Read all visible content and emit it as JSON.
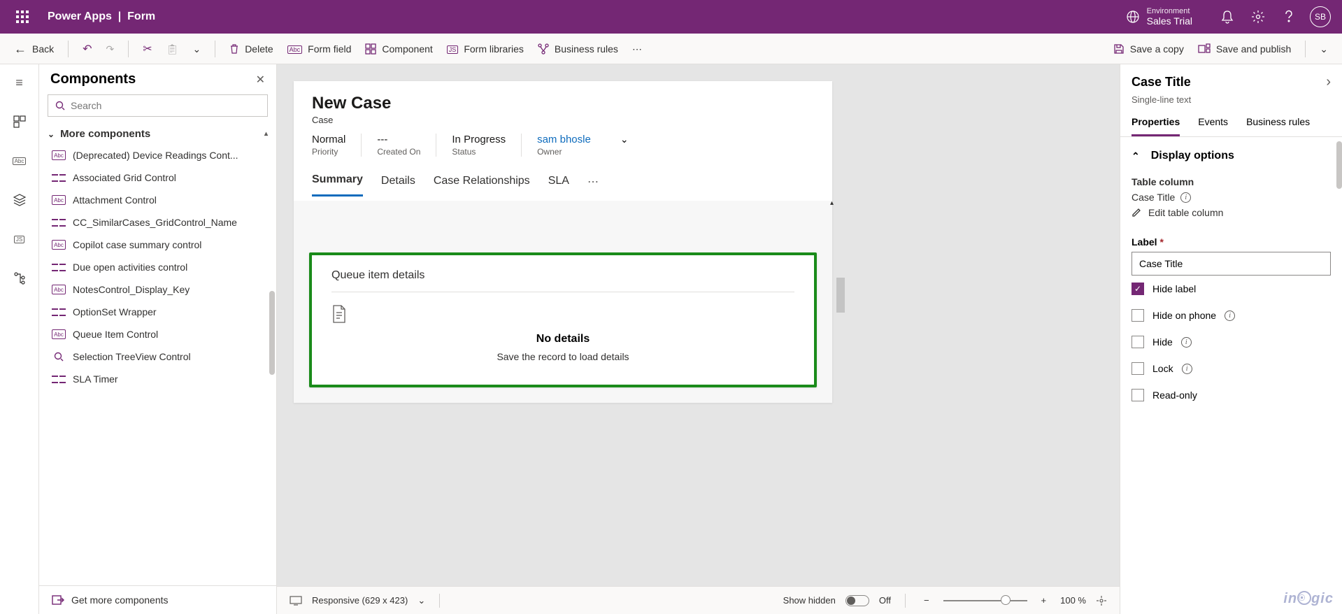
{
  "topbar": {
    "app": "Power Apps",
    "divider": "|",
    "page": "Form",
    "env_label": "Environment",
    "env_name": "Sales Trial",
    "avatar": "SB"
  },
  "cmdbar": {
    "back": "Back",
    "delete": "Delete",
    "form_field": "Form field",
    "component": "Component",
    "form_libraries": "Form libraries",
    "business_rules": "Business rules",
    "save_copy": "Save a copy",
    "save_publish": "Save and publish"
  },
  "leftpanel": {
    "title": "Components",
    "search_placeholder": "Search",
    "section": "More components",
    "items": [
      {
        "icon": "abc",
        "label": "(Deprecated) Device Readings Cont..."
      },
      {
        "icon": "grid",
        "label": "Associated Grid Control"
      },
      {
        "icon": "abc",
        "label": "Attachment Control"
      },
      {
        "icon": "grid",
        "label": "CC_SimilarCases_GridControl_Name"
      },
      {
        "icon": "abc",
        "label": "Copilot case summary control"
      },
      {
        "icon": "grid",
        "label": "Due open activities control"
      },
      {
        "icon": "abc",
        "label": "NotesControl_Display_Key"
      },
      {
        "icon": "grid",
        "label": "OptionSet Wrapper"
      },
      {
        "icon": "abc",
        "label": "Queue Item Control"
      },
      {
        "icon": "search",
        "label": "Selection TreeView Control"
      },
      {
        "icon": "grid",
        "label": "SLA Timer"
      }
    ],
    "footer": "Get more components"
  },
  "form": {
    "title": "New Case",
    "subtitle": "Case",
    "head_fields": [
      {
        "value": "Normal",
        "label": "Priority"
      },
      {
        "value": "---",
        "label": "Created On"
      },
      {
        "value": "In Progress",
        "label": "Status"
      },
      {
        "value": "sam bhosle",
        "label": "Owner",
        "link": true,
        "chev": true
      }
    ],
    "tabs": [
      "Summary",
      "Details",
      "Case Relationships",
      "SLA"
    ],
    "queue": {
      "title": "Queue item details",
      "empty_title": "No details",
      "empty_sub": "Save the record to load details"
    }
  },
  "statusbar": {
    "view": "Responsive (629 x 423)",
    "show_hidden": "Show hidden",
    "toggle": "Off",
    "zoom": "100 %"
  },
  "rightpanel": {
    "title": "Case Title",
    "subtitle": "Single-line text",
    "tabs": [
      "Properties",
      "Events",
      "Business rules"
    ],
    "display_section": "Display options",
    "table_col_lbl": "Table column",
    "table_col": "Case Title",
    "edit_link": "Edit table column",
    "label_lbl": "Label",
    "label_value": "Case Title",
    "checks": [
      {
        "label": "Hide label",
        "checked": true,
        "info": false
      },
      {
        "label": "Hide on phone",
        "checked": false,
        "info": true
      },
      {
        "label": "Hide",
        "checked": false,
        "info": true
      },
      {
        "label": "Lock",
        "checked": false,
        "info": true
      },
      {
        "label": "Read-only",
        "checked": false,
        "info": false
      }
    ]
  },
  "watermark": "inogic"
}
